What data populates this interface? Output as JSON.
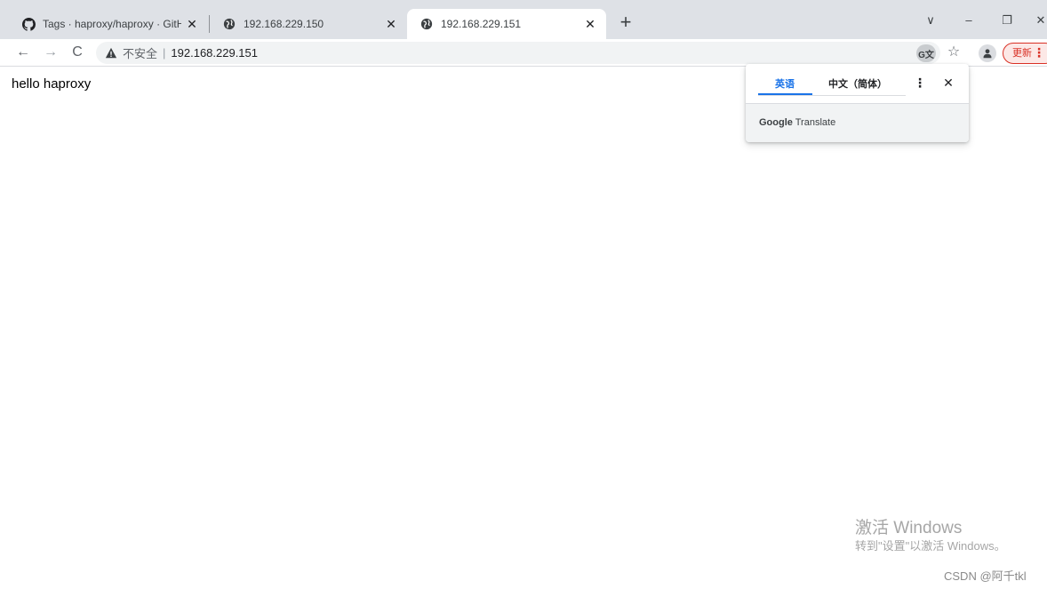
{
  "browser": {
    "tabs": [
      {
        "title": "Tags · haproxy/haproxy · GitHub",
        "icon": "github-icon",
        "active": false
      },
      {
        "title": "192.168.229.150",
        "icon": "globe-icon",
        "active": false
      },
      {
        "title": "192.168.229.151",
        "icon": "globe-icon",
        "active": true
      }
    ],
    "new_tab_label": "+",
    "window_controls": {
      "dropdown": "∨",
      "minimize": "–",
      "restore": "❐",
      "close": "✕"
    },
    "toolbar": {
      "back": "←",
      "forward": "→",
      "reload": "C",
      "security_label": "不安全",
      "separator": "|",
      "url": "192.168.229.151",
      "translate_label": "G文",
      "star": "☆",
      "update_label": "更新",
      "menu_dots": "⋮"
    }
  },
  "page": {
    "body_text": "hello haproxy"
  },
  "translate_popup": {
    "source_lang": "英语",
    "target_lang": "中文（简体）",
    "more": "⋮",
    "close": "✕",
    "brand_google": "Google",
    "brand_translate": "Translate"
  },
  "watermarks": {
    "activate_title": "激活 Windows",
    "activate_hint": "转到\"设置\"以激活 Windows。",
    "csdn": "CSDN @阿千tkl"
  },
  "colors": {
    "tabstrip_bg": "#dee1e6",
    "omnibox_bg": "#f1f3f4",
    "accent_blue": "#1a73e8",
    "update_red": "#d93025"
  }
}
